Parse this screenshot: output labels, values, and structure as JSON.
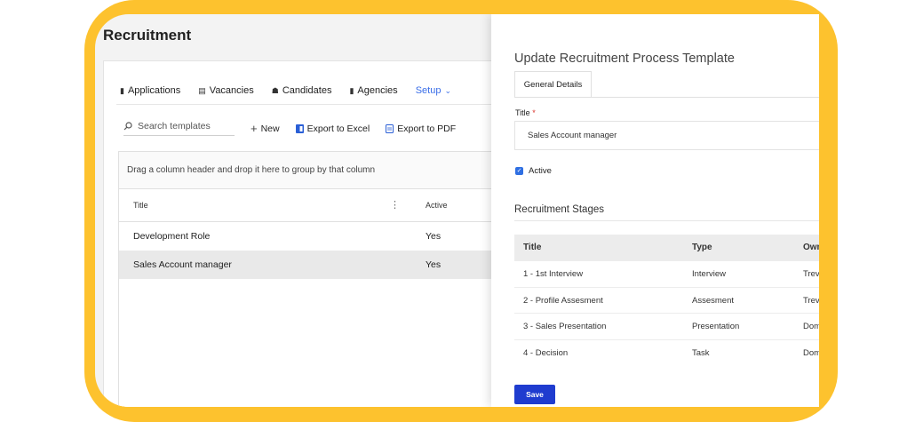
{
  "app": {
    "title": "Recruitment"
  },
  "nav": {
    "tabs": [
      {
        "label": "Applications",
        "icon": "document-icon"
      },
      {
        "label": "Vacancies",
        "icon": "table-icon"
      },
      {
        "label": "Candidates",
        "icon": "people-icon"
      },
      {
        "label": "Agencies",
        "icon": "building-icon"
      },
      {
        "label": "Setup",
        "icon": "chevron-down-icon"
      }
    ],
    "setup_chevron": "⌄"
  },
  "toolbar": {
    "search_placeholder": "Search templates",
    "new_label": "New",
    "export_excel_label": "Export to Excel",
    "export_pdf_label": "Export to PDF"
  },
  "grid": {
    "group_hint": "Drag a column header and drop it here to group by that column",
    "columns": [
      "Title",
      "Active"
    ],
    "rows": [
      {
        "title": "Development Role",
        "active": "Yes"
      },
      {
        "title": "Sales Account manager",
        "active": "Yes"
      }
    ]
  },
  "drawer": {
    "title": "Update Recruitment Process Template",
    "tab_label": "General Details",
    "title_label": "Title",
    "required_mark": "*",
    "title_value": "Sales Account manager",
    "active_label": "Active",
    "active_checked": true,
    "stages_heading": "Recruitment Stages",
    "stage_columns": [
      "Title",
      "Type",
      "Owner"
    ],
    "stages": [
      {
        "title": "1 - 1st Interview",
        "type": "Interview",
        "owner": "Trevor"
      },
      {
        "title": "2 - Profile Assesment",
        "type": "Assesment",
        "owner": "Trevor"
      },
      {
        "title": "3 - Sales Presentation",
        "type": "Presentation",
        "owner": "Dominic"
      },
      {
        "title": "4 - Decision",
        "type": "Task",
        "owner": "Dominic"
      }
    ],
    "save_label": "Save"
  },
  "colors": {
    "frame": "#fdc22e",
    "accent": "#1f3ccf",
    "link": "#3a6ee8",
    "checkbox": "#2f6fe2"
  }
}
